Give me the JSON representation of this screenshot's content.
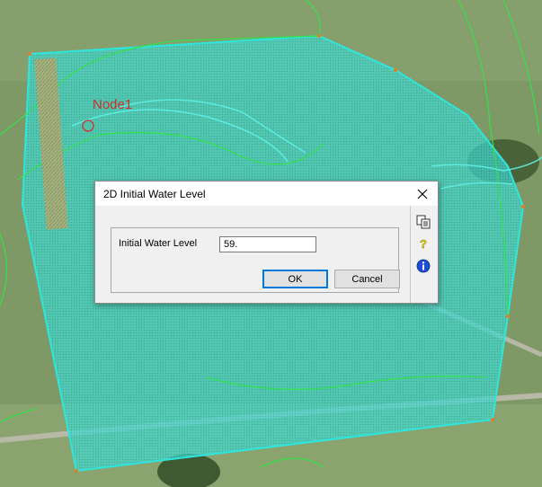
{
  "map": {
    "node_label": "Node1",
    "colors": {
      "mesh_fill": "#37e7e0",
      "mesh_edge": "#2de6dd",
      "contour": "#33e24a",
      "node_marker": "#d0312d"
    }
  },
  "dialog": {
    "title": "2D Initial Water Level",
    "field_label": "Initial Water Level",
    "field_value": "59.",
    "ok_label": "OK",
    "cancel_label": "Cancel",
    "side_icons": [
      "copy-icon",
      "help-icon",
      "info-icon"
    ]
  }
}
